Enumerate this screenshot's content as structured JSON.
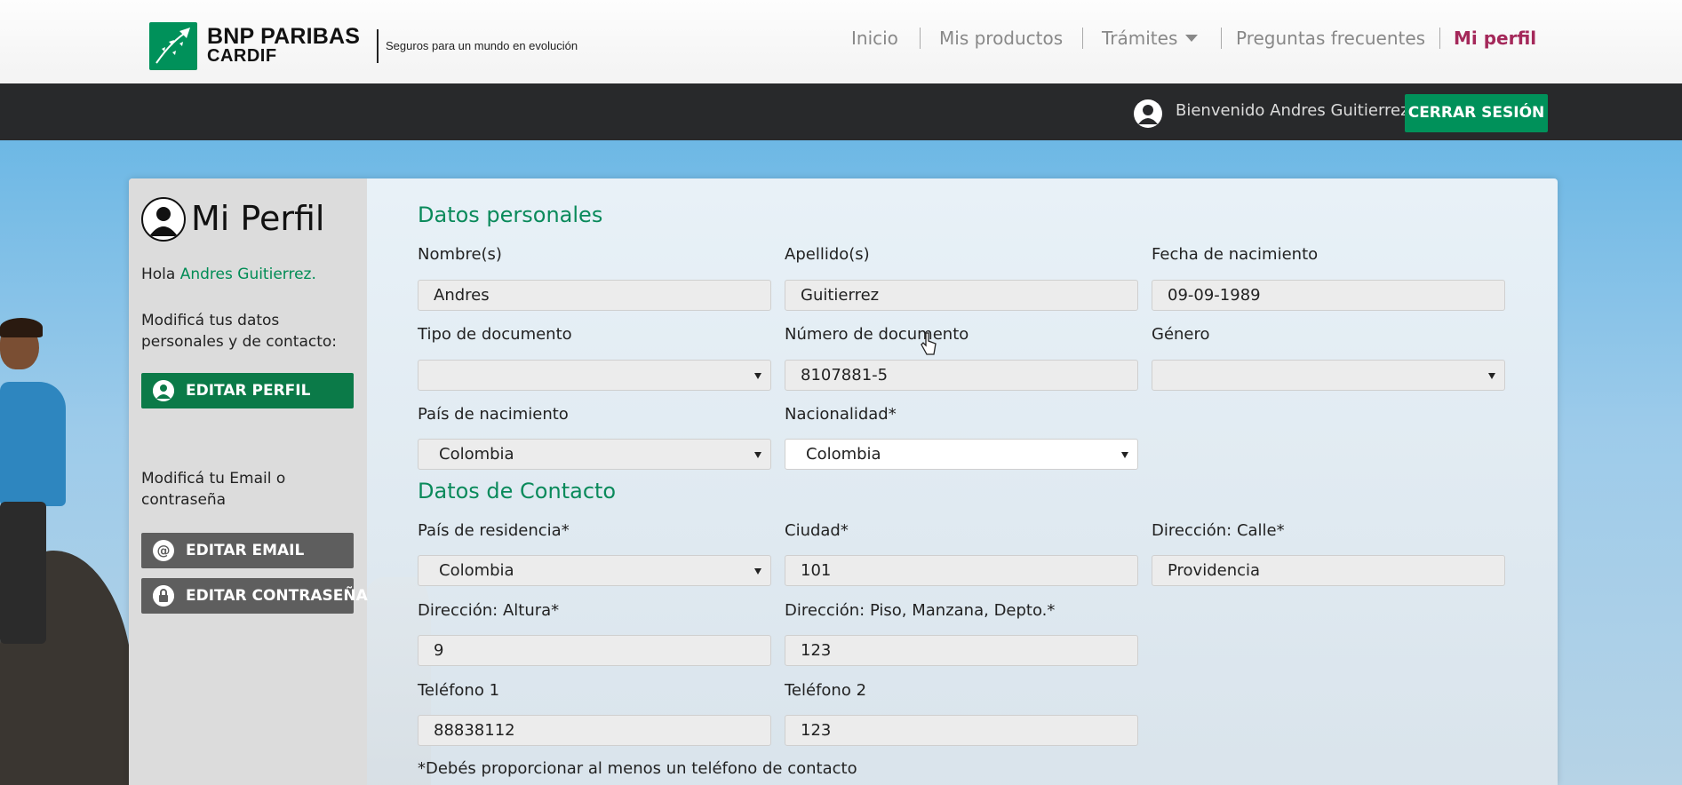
{
  "header": {
    "brand_line1": "BNP PARIBAS",
    "brand_line2": "CARDIF",
    "tagline": "Seguros para un mundo en evolución",
    "nav": [
      {
        "label": "Inicio"
      },
      {
        "label": "Mis productos"
      },
      {
        "label": "Trámites"
      },
      {
        "label": "Preguntas frecuentes"
      },
      {
        "label": "Mi perfil"
      }
    ],
    "active_color": "#a4285a"
  },
  "userbar": {
    "welcome": "Bienvenido Andres Guitierrez",
    "logout_label": "CERRAR SESIÓN",
    "accent": "#00915a"
  },
  "sidebar": {
    "title": "Mi Perfil",
    "hola_prefix": "Hola",
    "hola_name": "Andres Guitierrez.",
    "edit_profile_text": "Modificá tus datos personales y de contacto:",
    "edit_profile_label": "EDITAR PERFIL",
    "edit_email_text": "Modificá tu Email o contraseña",
    "edit_email_label": "EDITAR EMAIL",
    "edit_password_label": "EDITAR CONTRASEÑA"
  },
  "personal": {
    "title": "Datos personales",
    "nombre_label": "Nombre(s)",
    "nombre_value": "Andres",
    "apellido_label": "Apellido(s)",
    "apellido_value": "Guitierrez",
    "fecha_label": "Fecha de nacimiento",
    "fecha_value": "09-09-1989",
    "tipo_doc_label": "Tipo de documento",
    "tipo_doc_value": "",
    "num_doc_label": "Número de documento",
    "num_doc_value": "8107881-5",
    "genero_label": "Género",
    "genero_value": "",
    "pais_nac_label": "País de nacimiento",
    "pais_nac_value": "Colombia",
    "nacionalidad_label": "Nacionalidad*",
    "nacionalidad_value": "Colombia"
  },
  "contact": {
    "title": "Datos de Contacto",
    "pais_res_label": "País de residencia*",
    "pais_res_value": "Colombia",
    "ciudad_label": "Ciudad*",
    "ciudad_value": "101",
    "calle_label": "Dirección: Calle*",
    "calle_value": "Providencia",
    "altura_label": "Dirección: Altura*",
    "altura_value": "9",
    "piso_label": "Dirección: Piso, Manzana, Depto.*",
    "piso_value": "123",
    "tel1_label": "Teléfono 1",
    "tel1_value": "88838112",
    "tel2_label": "Teléfono 2",
    "tel2_value": "123",
    "note": "*Debés proporcionar al menos un teléfono de contacto"
  },
  "icons": [
    "bnp-paribas-logo-icon",
    "user-icon",
    "profile-icon",
    "user-button-icon",
    "at-icon",
    "lock-icon",
    "chevron-down-icon",
    "cursor-icon"
  ]
}
